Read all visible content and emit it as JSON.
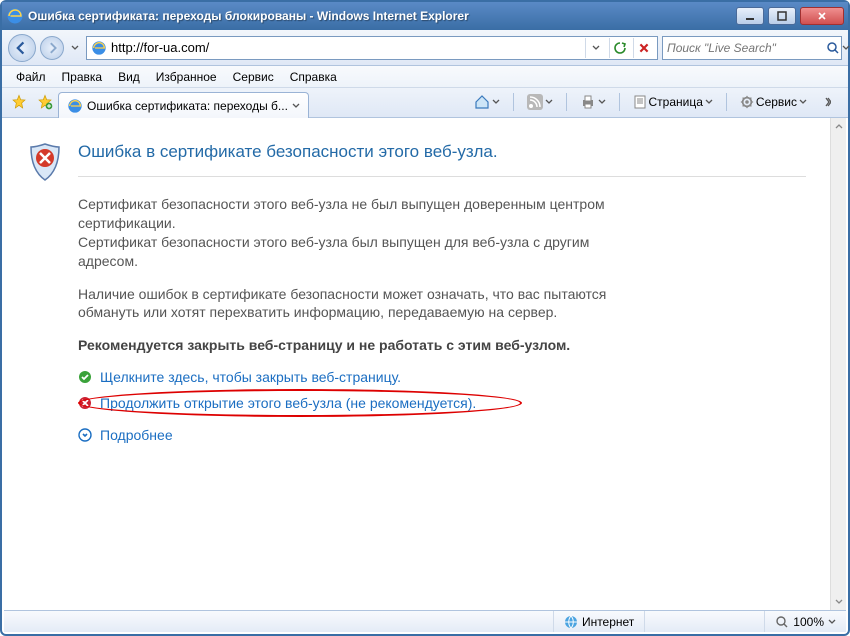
{
  "window": {
    "title": "Ошибка сертификата: переходы блокированы - Windows Internet Explorer"
  },
  "address": {
    "url": "http://for-ua.com/"
  },
  "search": {
    "placeholder": "Поиск \"Live Search\""
  },
  "menu": {
    "file": "Файл",
    "edit": "Правка",
    "view": "Вид",
    "favorites": "Избранное",
    "tools": "Сервис",
    "help": "Справка"
  },
  "tab": {
    "title": "Ошибка сертификата: переходы б..."
  },
  "toolbar": {
    "page": "Страница",
    "service": "Сервис"
  },
  "cert": {
    "heading": "Ошибка в сертификате безопасности этого веб-узла.",
    "p1": "Сертификат безопасности этого веб-узла не был выпущен доверенным центром сертификации.",
    "p2": "Сертификат безопасности этого веб-узла был выпущен для веб-узла с другим адресом.",
    "p3": "Наличие ошибок в сертификате безопасности может означать, что вас пытаются обмануть или хотят перехватить информацию, передаваемую на сервер.",
    "p4": "Рекомендуется закрыть веб-страницу и не работать с этим веб-узлом.",
    "close_link": "Щелкните здесь, чтобы закрыть веб-страницу.",
    "continue_link": "Продолжить открытие этого веб-узла (не рекомендуется).",
    "more_link": "Подробнее"
  },
  "status": {
    "zone": "Интернет",
    "zoom": "100%"
  }
}
